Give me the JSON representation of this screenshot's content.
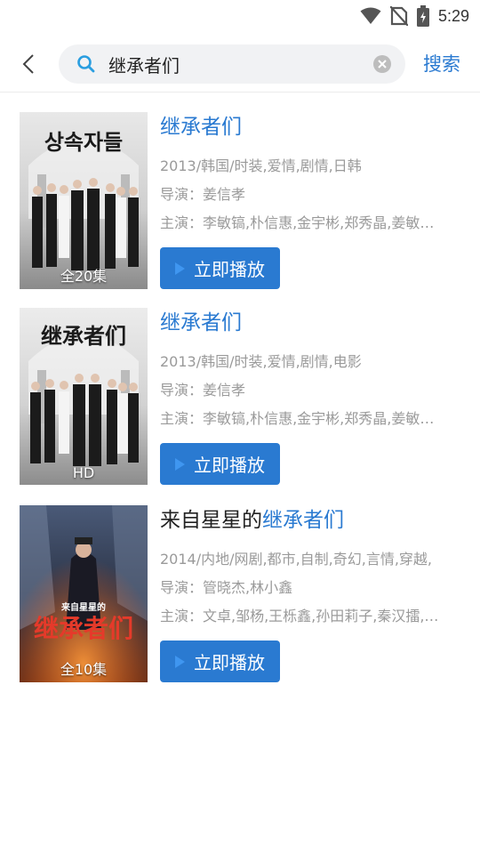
{
  "status_bar": {
    "time": "5:29",
    "icons": [
      "wifi-icon",
      "no-sim-icon",
      "battery-charging-icon"
    ]
  },
  "header": {
    "back_icon": "chevron-left-icon",
    "search_icon": "search-icon",
    "query": "继承者们",
    "clear_icon": "clear-icon",
    "search_label": "搜索",
    "accent_color": "#2a7ad1"
  },
  "results": [
    {
      "title_prefix": "",
      "title_highlight": "继承者们",
      "info": "2013/韩国/时装,爱情,剧情,日韩",
      "director": "导演：姜信孝",
      "cast": "主演：李敏镐,朴信惠,金宇彬,郑秀晶,姜敏…",
      "badge": "全20集",
      "poster_title": "상속자들",
      "play_label": "立即播放",
      "play_icon": "play-icon"
    },
    {
      "title_prefix": "",
      "title_highlight": "继承者们",
      "info": "2013/韩国/时装,爱情,剧情,电影",
      "director": "导演：姜信孝",
      "cast": "主演：李敏镐,朴信惠,金宇彬,郑秀晶,姜敏…",
      "badge": "HD",
      "poster_title": "继承者们",
      "play_label": "立即播放",
      "play_icon": "play-icon"
    },
    {
      "title_prefix": "来自星星的",
      "title_highlight": "继承者们",
      "info": "2014/内地/网剧,都市,自制,奇幻,言情,穿越,",
      "director": "导演：管晓杰,林小鑫",
      "cast": "主演：文卓,邹杨,王栎鑫,孙田莉子,秦汉擂,…",
      "badge": "全10集",
      "poster_title": "继承者们",
      "poster_subtitle": "来自星星的",
      "play_label": "立即播放",
      "play_icon": "play-icon"
    }
  ]
}
